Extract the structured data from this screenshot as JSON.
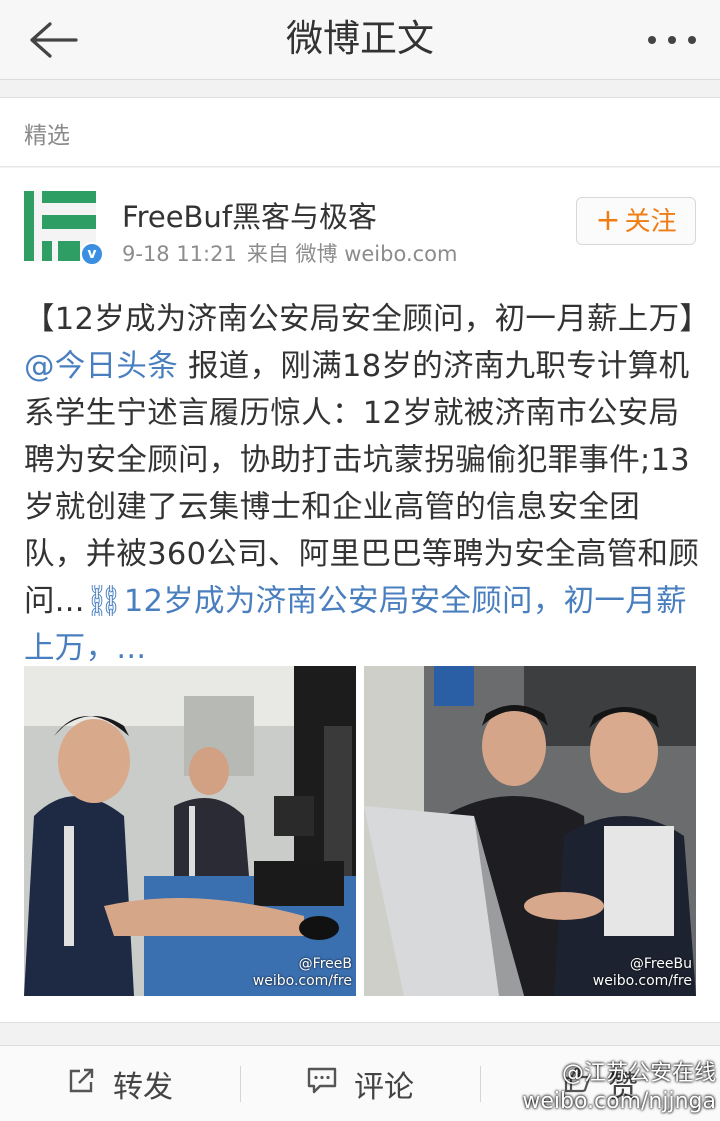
{
  "header": {
    "title": "微博正文",
    "back_icon": "arrow-left-icon",
    "more_icon": "more-dots-icon"
  },
  "section": {
    "label": "精选"
  },
  "post": {
    "author": "FreeBuf黑客与极客",
    "time": "9-18 11:21",
    "source": "来自 微博 weibo.com",
    "follow_label": "关注",
    "verified_badge": "v",
    "text_open": "【12岁成为济南公安局安全顾问，初一月薪上万】",
    "mention": "@今日头条",
    "text_body": " 报道，刚满18岁的济南九职专计算机系学生宁述言履历惊人：12岁就被济南市公安局聘为安全顾问，协助打击坑蒙拐骗偷犯罪事件;13岁就创建了云集博士和企业高管的信息安全团队，并被360公司、阿里巴巴等聘为安全高管和顾问...",
    "link_text": "12岁成为济南公安局安全顾问，初一月薪上万，...",
    "images": [
      {
        "watermark_line1": "@FreeB",
        "watermark_line2": "weibo.com/fre"
      },
      {
        "watermark_line1": "@FreeBu",
        "watermark_line2": "weibo.com/fre"
      }
    ]
  },
  "actions": {
    "repost": "转发",
    "comment": "评论",
    "like": "赞"
  },
  "watermark": {
    "line1": "@江苏公安在线",
    "line2": "weibo.com/njjnga"
  },
  "colors": {
    "accent": "#f07d14",
    "link": "#4a7fbf",
    "brand_green": "#2f9e65",
    "verified": "#3b8fe0"
  }
}
